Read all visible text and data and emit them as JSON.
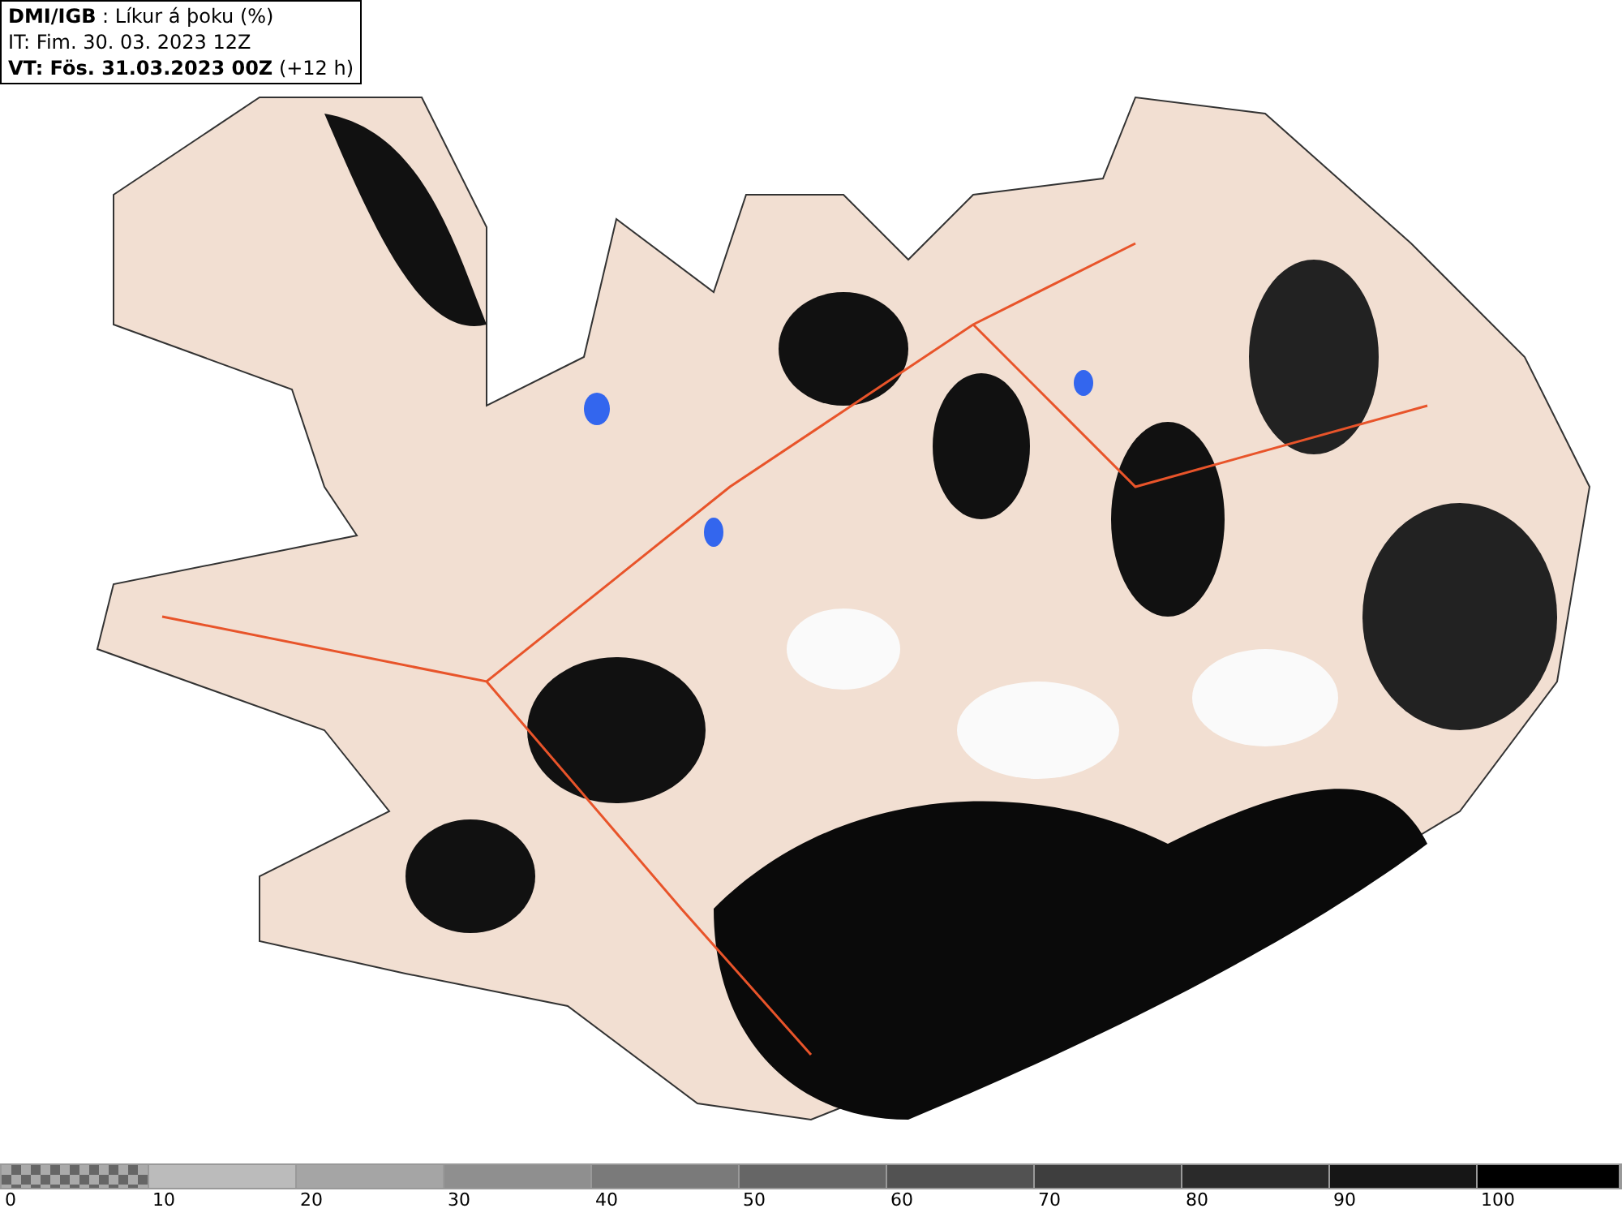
{
  "header": {
    "title": "**DMI/IGB** : Líkur á þoku (%)",
    "issue_time": "IT: Fim. 30. 03. 2023 12Z",
    "valid_time": "**VT: Fös. 31.03.2023 00Z** (+12 h)"
  },
  "legend": {
    "segments": [
      {
        "kind": "pattern",
        "color": "#aaaaaa"
      },
      {
        "kind": "solid",
        "color": "#bbbbbb"
      },
      {
        "kind": "solid",
        "color": "#a5a5a5"
      },
      {
        "kind": "solid",
        "color": "#8f8f8f"
      },
      {
        "kind": "solid",
        "color": "#7a7a7a"
      },
      {
        "kind": "solid",
        "color": "#666666"
      },
      {
        "kind": "solid",
        "color": "#525252"
      },
      {
        "kind": "solid",
        "color": "#3e3e3e"
      },
      {
        "kind": "solid",
        "color": "#2a2a2a"
      },
      {
        "kind": "solid",
        "color": "#161616"
      },
      {
        "kind": "solid",
        "color": "#000000"
      }
    ],
    "ticks": [
      "0",
      "10",
      "20",
      "30",
      "40",
      "50",
      "60",
      "70",
      "80",
      "90",
      "100"
    ]
  }
}
